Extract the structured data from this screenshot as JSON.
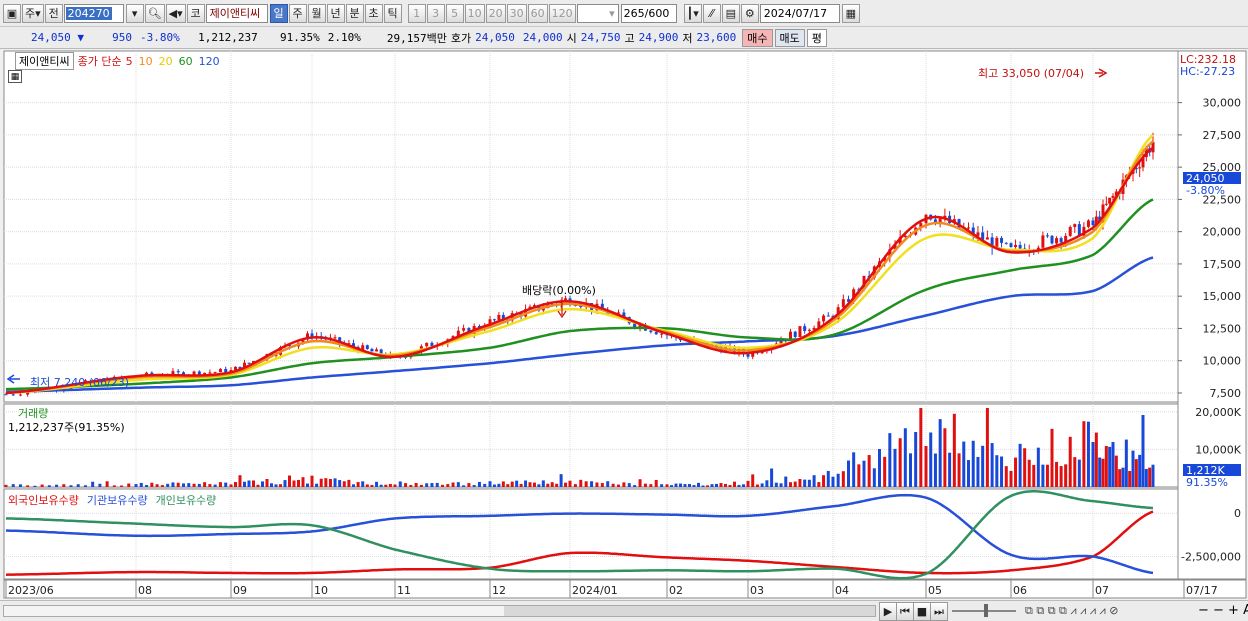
{
  "toolbar": {
    "market": "주",
    "prev": "전",
    "code": "204270",
    "name_button": "코",
    "name": "제이앤티씨",
    "periods": [
      "일",
      "주",
      "월",
      "년",
      "분",
      "초",
      "틱"
    ],
    "active_period": "일",
    "intervals": [
      "1",
      "3",
      "5",
      "10",
      "20",
      "30",
      "60",
      "120"
    ],
    "count": "265",
    "count_max": "/600",
    "date": "2024/07/17"
  },
  "quote": {
    "price": "24,050",
    "change": "950",
    "change_pct": "-3.80%",
    "volume": "1,212,237",
    "vol_ratio": "91.35%",
    "turnover": "2.10%",
    "amount": "29,157백만",
    "hoga_label": "호가",
    "hoga1": "24,050",
    "hoga2": "24,000",
    "open_label": "시",
    "open": "24,750",
    "high_label": "고",
    "high": "24,900",
    "low_label": "저",
    "low": "23,600",
    "buy_label": "매수",
    "sell_label": "매도",
    "eval_label": "평"
  },
  "legend": {
    "name": "제이앤티씨",
    "ma_title": "종가 단순",
    "ma_periods": [
      "5",
      "10",
      "20",
      "60",
      "120"
    ]
  },
  "colors": {
    "up": "#e01010",
    "down": "#1848d8",
    "ma5": "#e01010",
    "ma10": "#f08a20",
    "ma20": "#f0e020",
    "ma60": "#209020",
    "ma120": "#2850d8",
    "foreign": "#e01010",
    "institution": "#2850d8",
    "individual": "#309060"
  },
  "annotations": {
    "high": "최고 33,050 (07/04)",
    "low": "최저 7,240 (06/23)",
    "dividend": "배당락(0.00%)",
    "lc": "LC:232.18",
    "hc": "HC:-27.23",
    "price_tag": "24,050",
    "pct_tag": "-3.80%"
  },
  "volume_pane": {
    "title": "거래량",
    "value": "1,212,237주(91.35%)",
    "tag": "1,212K",
    "tag_pct": "91.35%"
  },
  "holdings_pane": {
    "labels": [
      "외국인보유수량",
      "기관보유수량",
      "개인보유수량"
    ]
  },
  "chart_data": [
    {
      "type": "line",
      "title": "제이앤티씨 일봉 (종가 단순 이동평균 5 10 20 60 120)",
      "x": [
        "2023/06",
        "2023/07",
        "2023/08",
        "2023/09",
        "2023/10",
        "2023/11",
        "2023/12",
        "2024/01",
        "2024/02",
        "2024/03",
        "2024/04",
        "2024/05",
        "2024/06",
        "2024/07"
      ],
      "series": [
        {
          "name": "종가",
          "values": [
            7400,
            8800,
            9200,
            12000,
            10200,
            13000,
            14800,
            12000,
            10500,
            13500,
            21500,
            18500,
            20500,
            27000
          ]
        },
        {
          "name": "5",
          "values": [
            7500,
            8800,
            9100,
            11800,
            10300,
            12800,
            14600,
            12100,
            10600,
            13300,
            21000,
            18400,
            20300,
            26500
          ]
        },
        {
          "name": "10",
          "values": [
            7500,
            8700,
            9000,
            11500,
            10400,
            12600,
            14400,
            12200,
            10800,
            13100,
            20500,
            18500,
            20000,
            27000
          ]
        },
        {
          "name": "20",
          "values": [
            7500,
            8500,
            8900,
            11000,
            10500,
            12300,
            14000,
            12300,
            11000,
            12800,
            19500,
            18600,
            19500,
            27500
          ]
        },
        {
          "name": "60",
          "values": [
            7800,
            8200,
            8700,
            9800,
            10300,
            11000,
            12300,
            12500,
            11800,
            12000,
            15500,
            17000,
            18200,
            22500
          ]
        },
        {
          "name": "120",
          "values": [
            7600,
            7900,
            8100,
            8700,
            9200,
            9800,
            10500,
            11200,
            11500,
            11900,
            13500,
            15000,
            15400,
            18000
          ]
        }
      ],
      "ylim": [
        6800,
        34000
      ],
      "yticks": [
        "7,500",
        "10,000",
        "12,500",
        "15,000",
        "17,500",
        "20,000",
        "22,500",
        "25,000",
        "27,500",
        "30,000"
      ],
      "xticks": [
        "2023/06",
        "08",
        "09",
        "10",
        "11",
        "12",
        "2024/01",
        "02",
        "03",
        "04",
        "05",
        "06",
        "07",
        "07/17"
      ]
    },
    {
      "type": "bar",
      "title": "거래량",
      "x": [
        "2023/06",
        "2023/07",
        "2023/08",
        "2023/09",
        "2023/10",
        "2023/11",
        "2023/12",
        "2024/01",
        "2024/02",
        "2024/03",
        "2024/04",
        "2024/05",
        "2024/06",
        "2024/07"
      ],
      "values": [
        600000,
        900000,
        1100000,
        2200000,
        800000,
        1200000,
        1600000,
        700000,
        1300000,
        3500000,
        20000000,
        8000000,
        16000000,
        5000000
      ],
      "ylim": [
        0,
        21000000
      ],
      "yticks": [
        "10,000K",
        "20,000K"
      ]
    },
    {
      "type": "line",
      "title": "외국인보유수량 기관보유수량 개인보유수량",
      "x": [
        "2023/06",
        "2023/07",
        "2023/08",
        "2023/09",
        "2023/10",
        "2023/11",
        "2023/12",
        "2024/01",
        "2024/02",
        "2024/03",
        "2024/04",
        "2024/05",
        "2024/06",
        "2024/07"
      ],
      "series": [
        {
          "name": "외국인보유수량",
          "values": [
            -3550000,
            -3400000,
            -3450000,
            -3450000,
            -3250000,
            -3150000,
            -2300000,
            -2550000,
            -2750000,
            -3100000,
            -3450000,
            -3300000,
            -2500000,
            100000
          ]
        },
        {
          "name": "기관보유수량",
          "values": [
            -1000000,
            -1300000,
            -1200000,
            -1050000,
            -300000,
            -150000,
            -20000,
            -80000,
            -150000,
            400000,
            900000,
            -2400000,
            -2500000,
            -3450000
          ]
        },
        {
          "name": "개인보유수량",
          "values": [
            -300000,
            -600000,
            -800000,
            -700000,
            -2100000,
            -3200000,
            -3350000,
            -3300000,
            -3350000,
            -3200000,
            -3500000,
            1000000,
            700000,
            300000
          ]
        }
      ],
      "ylim": [
        -3800000,
        1400000
      ],
      "yticks": [
        "0",
        "-2,500,000"
      ]
    }
  ]
}
